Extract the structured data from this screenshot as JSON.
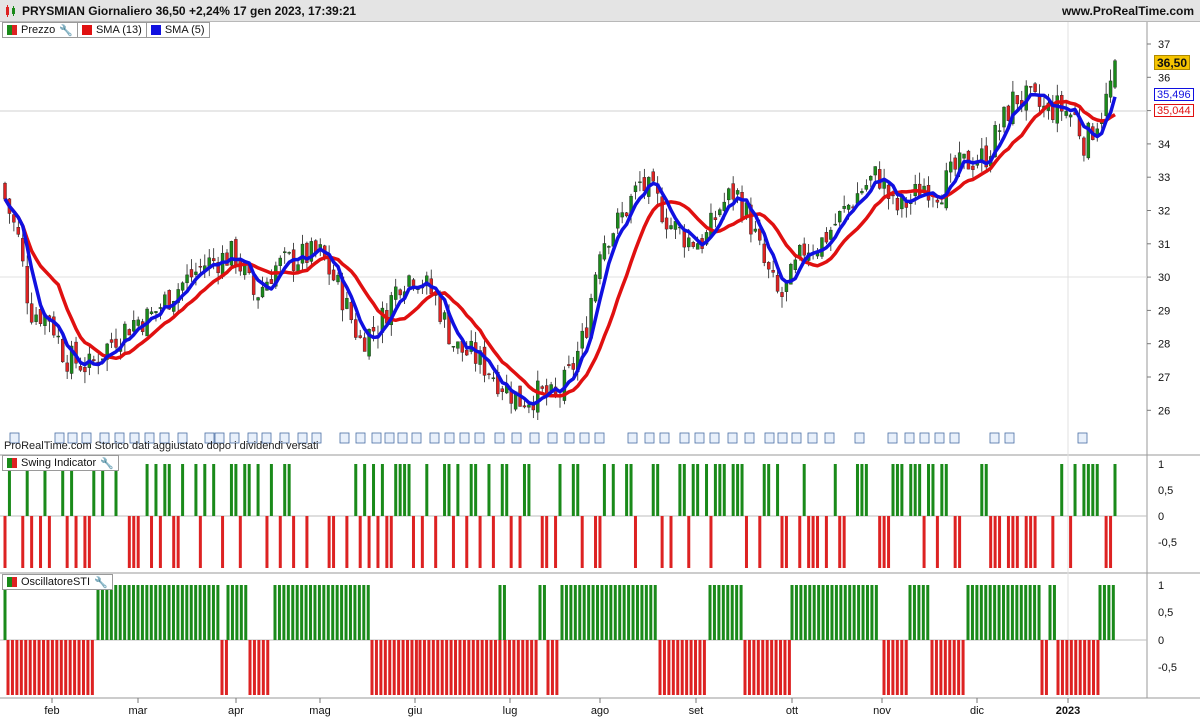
{
  "header": {
    "title": "PRYSMIAN Giornaliero 36,50 +2,24% 17 gen 2023, 17:39:21",
    "url": "www.ProRealTime.com"
  },
  "main_legend": [
    {
      "label": "Prezzo",
      "color": "split",
      "wrench": true
    },
    {
      "label": "SMA (13)",
      "color": "red"
    },
    {
      "label": "SMA (5)",
      "color": "blue"
    }
  ],
  "price_axis": {
    "ticks": [
      "37",
      "36",
      "35",
      "34",
      "33",
      "32",
      "31",
      "30",
      "29",
      "28",
      "27",
      "26"
    ],
    "last_price": "36,50",
    "sma5_value": "35,496",
    "sma13_value": "35,044"
  },
  "history_note": "ProRealTime.com Storico dati aggiustato dopo i dividendi versati",
  "swing_panel": {
    "label": "Swing Indicator",
    "ticks": [
      "1",
      "0,5",
      "0",
      "-0,5"
    ]
  },
  "sti_panel": {
    "label": "OscillatoreSTI",
    "ticks": [
      "1",
      "0,5",
      "0",
      "-0,5"
    ]
  },
  "x_axis": {
    "months": [
      "feb",
      "mar",
      "apr",
      "mag",
      "giu",
      "lug",
      "ago",
      "set",
      "ott",
      "nov",
      "dic",
      "2023"
    ]
  },
  "colors": {
    "up": "#1a8a1a",
    "down": "#dd2222",
    "sma13": "#e01010",
    "sma5": "#1010e0",
    "price_tag": "#f5c400"
  },
  "chart_data": {
    "type": "candlestick",
    "period": "daily",
    "ylim": [
      25.4,
      37.3
    ],
    "approx_close_path": [
      {
        "x": "early feb",
        "y": 32.8
      },
      {
        "x": "mid feb",
        "y": 29.0
      },
      {
        "x": "late feb",
        "y": 27.5
      },
      {
        "x": "mar",
        "y": 28.5
      },
      {
        "x": "apr",
        "y": 30.6
      },
      {
        "x": "late apr",
        "y": 29.5
      },
      {
        "x": "mag",
        "y": 30.7
      },
      {
        "x": "late mag",
        "y": 28.2
      },
      {
        "x": "giu",
        "y": 30.0
      },
      {
        "x": "late giu",
        "y": 27.5
      },
      {
        "x": "lug",
        "y": 26.2
      },
      {
        "x": "late lug",
        "y": 28.0
      },
      {
        "x": "ago",
        "y": 31.5
      },
      {
        "x": "mid ago",
        "y": 32.8
      },
      {
        "x": "set",
        "y": 31.0
      },
      {
        "x": "mid set",
        "y": 32.2
      },
      {
        "x": "late set",
        "y": 29.2
      },
      {
        "x": "ott",
        "y": 30.8
      },
      {
        "x": "late ott",
        "y": 33.0
      },
      {
        "x": "nov",
        "y": 31.8
      },
      {
        "x": "late nov",
        "y": 32.6
      },
      {
        "x": "dic",
        "y": 33.6
      },
      {
        "x": "mid dic",
        "y": 35.5
      },
      {
        "x": "late dic",
        "y": 35.0
      },
      {
        "x": "2023",
        "y": 34.3
      },
      {
        "x": "17 gen 2023",
        "y": 36.5
      }
    ],
    "series": [
      {
        "name": "SMA (13)",
        "last": 35.044
      },
      {
        "name": "SMA (5)",
        "last": 35.496
      }
    ]
  }
}
